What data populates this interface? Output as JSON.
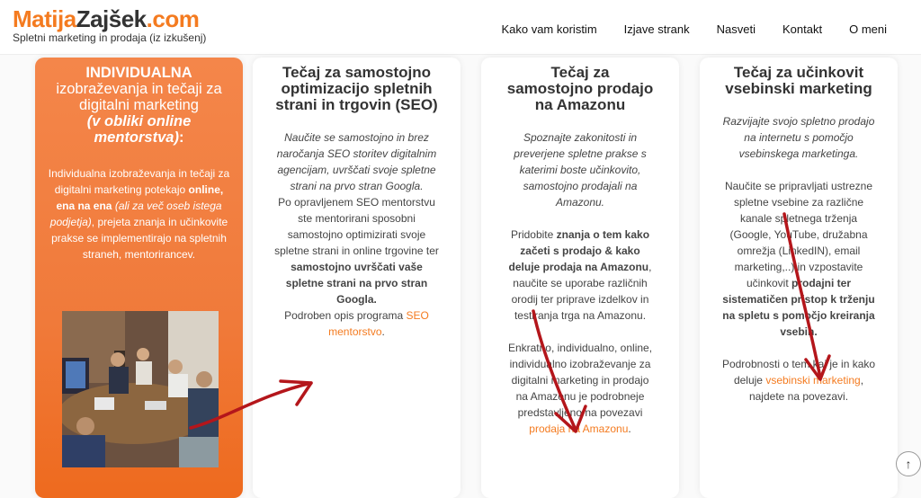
{
  "logo": {
    "matija": "Matija",
    "zajsek": "Zajšek",
    "com": ".com",
    "tagline": "Spletni marketing in prodaja (iz izkušenj)"
  },
  "nav": [
    "Kako vam koristim",
    "Izjave strank",
    "Nasveti",
    "Kontakt",
    "O meni"
  ],
  "card1": {
    "title_main": "INDIVIDUALNA",
    "title_rest": "izobraževanja in tečaji za digitalni marketing",
    "title_italic": "(v obliki online mentorstva)",
    "title_colon": ":",
    "p_a": "Individualna izobraževanja in tečaji za digitalni marketing potekajo ",
    "p_b": "online, ena na ena",
    "p_c": " (ali za več oseb istega podjetja)",
    "p_d": ", prejeta znanja in učinkovite prakse se implementirajo na spletnih straneh, mentorirancev."
  },
  "card2": {
    "title": "Tečaj za samostojno optimizacijo spletnih strani in trgovin (SEO)",
    "intro": "Naučite se samostojno in brez naročanja SEO storitev digitalnim agencijam, uvrščati svoje spletne strani na prvo stran Googla.",
    "p_a": "Po opravljenem SEO mentorstvu ste mentorirani sposobni samostojno optimizirati svoje spletne strani in online trgovine ter ",
    "p_b": "samostojno uvrščati vaše spletne strani na prvo stran Googla.",
    "p_c": "Podroben opis programa ",
    "link": "SEO mentorstvo",
    "p_d": "."
  },
  "card3": {
    "title": "Tečaj za samostojno prodajo na Amazonu",
    "intro": "Spoznajte zakonitosti in preverjene spletne prakse s katerimi boste učinkovito, samostojno prodajali na Amazonu.",
    "p_a": "Pridobite ",
    "p_b": "znanja o tem kako začeti s prodajo & kako deluje prodaja na Amazonu",
    "p_c": ", naučite se uporabe različnih orodij ter priprave izdelkov in testiranja trga na Amazonu.",
    "p_d": "Enkratno, individualno, online, individualno izobraževanje za digitalni marketing in prodajo na Amazonu je podrobneje predstavljeno na povezavi ",
    "link": "prodaja na Amazonu",
    "p_e": "."
  },
  "card4": {
    "title": "Tečaj za učinkovit vsebinski marketing",
    "intro": "Razvijajte svojo spletno prodajo na internetu s pomočjo vsebinskega marketinga.",
    "p_a": "Naučite se pripravljati ustrezne spletne vsebine za različne kanale spletnega trženja (Google, YouTube, družabna omrežja (LinkedIN), email marketing,..) in vzpostavite učinkovit ",
    "p_b": "prodajni ter sistematičen pristop k trženju na spletu s pomočjo kreiranja vsebin.",
    "p_c": "Podrobnosti o tem kaj je in kako deluje ",
    "link": "vsebinski marketing",
    "p_d": ", najdete na povezavi."
  },
  "scroll_top_icon": "↑",
  "colors": {
    "accent": "#f47b20",
    "arrow": "#b4161b"
  }
}
